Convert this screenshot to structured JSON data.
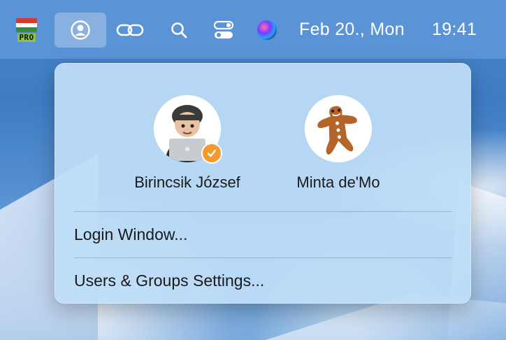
{
  "menubar": {
    "flag_icon": "hungarian-flag-icon",
    "flag_badge": "PRO",
    "date": "Feb 20., Mon",
    "time": "19:41",
    "icons": [
      "user-circle-icon",
      "link-icon",
      "search-icon",
      "control-center-icon",
      "siri-icon"
    ]
  },
  "popup": {
    "users": [
      {
        "name": "Birincsik József",
        "avatar": "memoji-laptop",
        "logged_in": true
      },
      {
        "name": "Minta de'Mo",
        "avatar": "gingerbread-man"
      }
    ],
    "menu_items": [
      {
        "label": "Login Window..."
      },
      {
        "label": "Users & Groups Settings..."
      }
    ],
    "accent_color": "#f39a2e"
  }
}
